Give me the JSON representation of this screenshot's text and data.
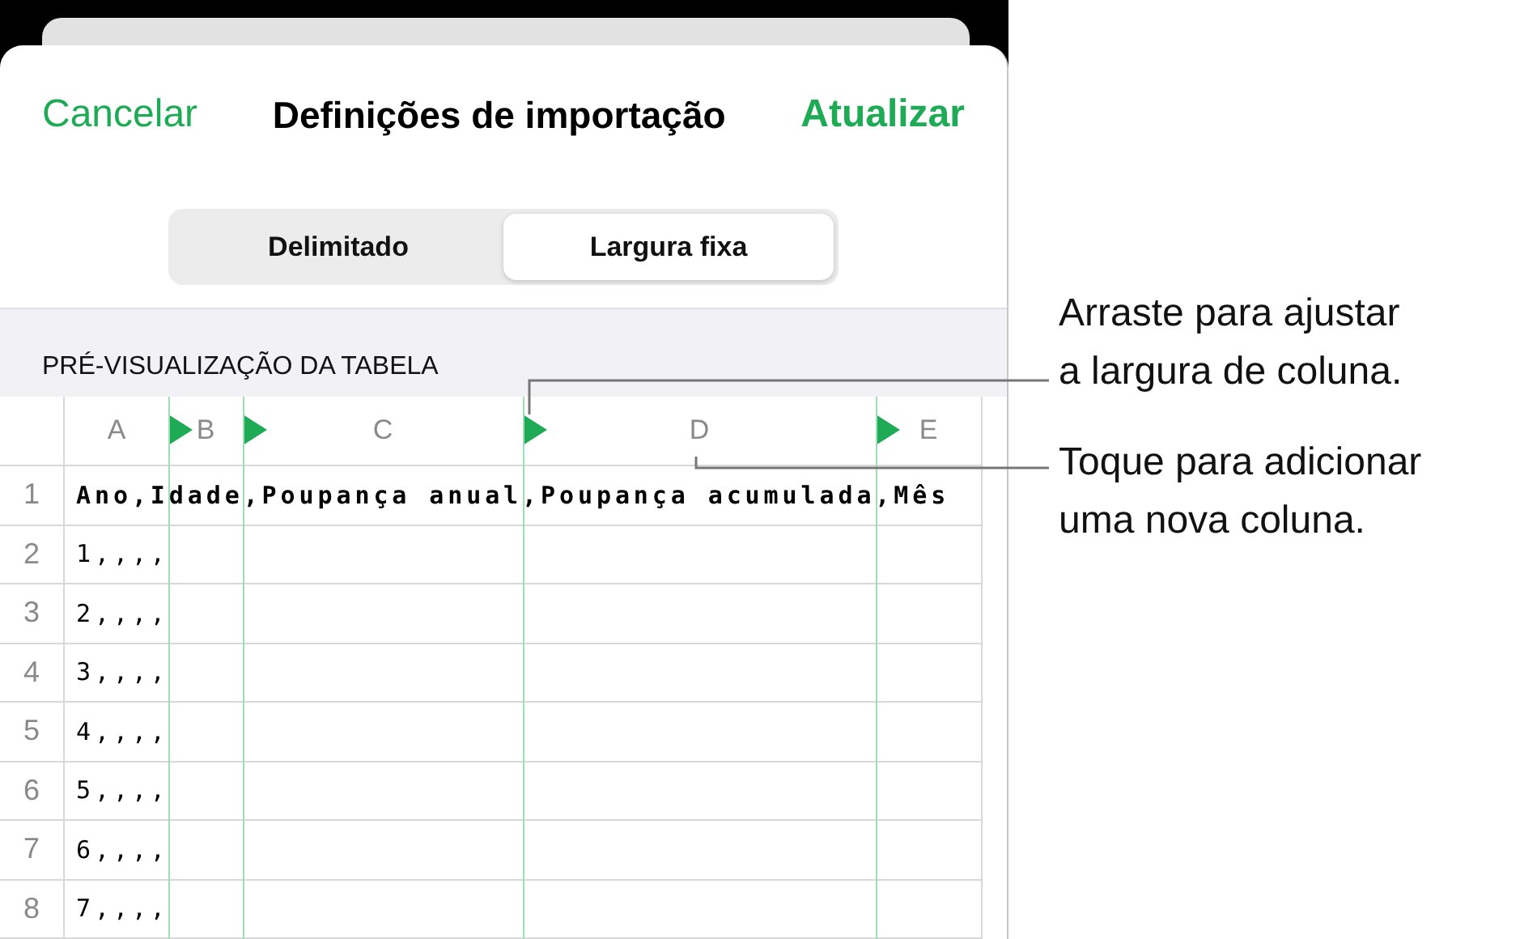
{
  "header": {
    "cancel": "Cancelar",
    "title": "Definições de importação",
    "update": "Atualizar"
  },
  "segments": [
    {
      "label": "Delimitado",
      "selected": false
    },
    {
      "label": "Largura fixa",
      "selected": true
    }
  ],
  "section_label": "PRÉ-VISUALIZAÇÃO DA TABELA",
  "table": {
    "columns": [
      {
        "label": "A"
      },
      {
        "label": "B"
      },
      {
        "label": "C"
      },
      {
        "label": "D"
      },
      {
        "label": "E"
      }
    ],
    "rows": [
      {
        "number": "1",
        "text": "Ano,Idade,Poupança anual,Poupança acumulada,Mês",
        "bold": true
      },
      {
        "number": "2",
        "text": "1,,,,",
        "bold": false
      },
      {
        "number": "3",
        "text": "2,,,,",
        "bold": false
      },
      {
        "number": "4",
        "text": "3,,,,",
        "bold": false
      },
      {
        "number": "5",
        "text": "4,,,,",
        "bold": false
      },
      {
        "number": "6",
        "text": "5,,,,",
        "bold": false
      },
      {
        "number": "7",
        "text": "6,,,,",
        "bold": false
      },
      {
        "number": "8",
        "text": "7,,,,",
        "bold": false
      }
    ]
  },
  "callouts": [
    "Arraste para ajustar a largura de coluna.",
    "Toque para adicionar uma nova coluna."
  ]
}
